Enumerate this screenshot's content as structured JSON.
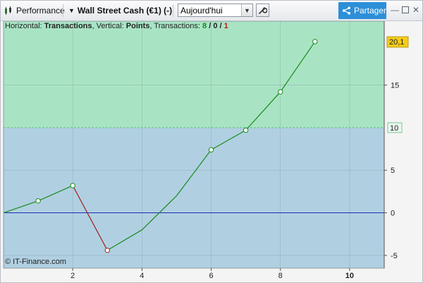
{
  "toolbar": {
    "module_label": "Performance",
    "instrument_label": "Wall Street Cash (€1) (-)",
    "period_select": "Aujourd'hui",
    "share_label": "Partager"
  },
  "header": {
    "h_prefix": "Horizontal: ",
    "h_value": "Transactions",
    "v_prefix": ", Vertical: ",
    "v_value": "Points",
    "t_prefix": ", Transactions: ",
    "wins": "8",
    "sep1": " / ",
    "neutral": "0",
    "sep2": " / ",
    "losses": "1"
  },
  "watermark": "© IT-Finance.com",
  "colors": {
    "zone_above": "#a8e4c4",
    "zone_below": "#b0d0e2",
    "gain_line": "#1a8a1a",
    "loss_line": "#a42020",
    "zero_line": "#1f2db0",
    "last_value_badge": "#f5cc1a"
  },
  "chart_data": {
    "type": "line",
    "xlabel": "",
    "ylabel": "",
    "xlim": [
      0,
      11
    ],
    "ylim": [
      -6.5,
      22.5
    ],
    "x_ticks": [
      2,
      4,
      6,
      8,
      10
    ],
    "y_ticks": [
      -5,
      0,
      5,
      15
    ],
    "grid": true,
    "reference_level": 10,
    "reference_label": "10",
    "last_value_label": "20,1",
    "series": [
      {
        "x": [
          0,
          1,
          2,
          3,
          4,
          5,
          6,
          7,
          8,
          9
        ],
        "y": [
          0,
          1.4,
          3.2,
          -4.4,
          -2,
          2,
          7.4,
          9.7,
          14.2,
          20.1
        ],
        "markers": [
          1,
          2,
          3,
          6,
          7,
          8,
          9
        ],
        "loss_segments": [
          [
            2,
            3
          ]
        ]
      }
    ]
  }
}
